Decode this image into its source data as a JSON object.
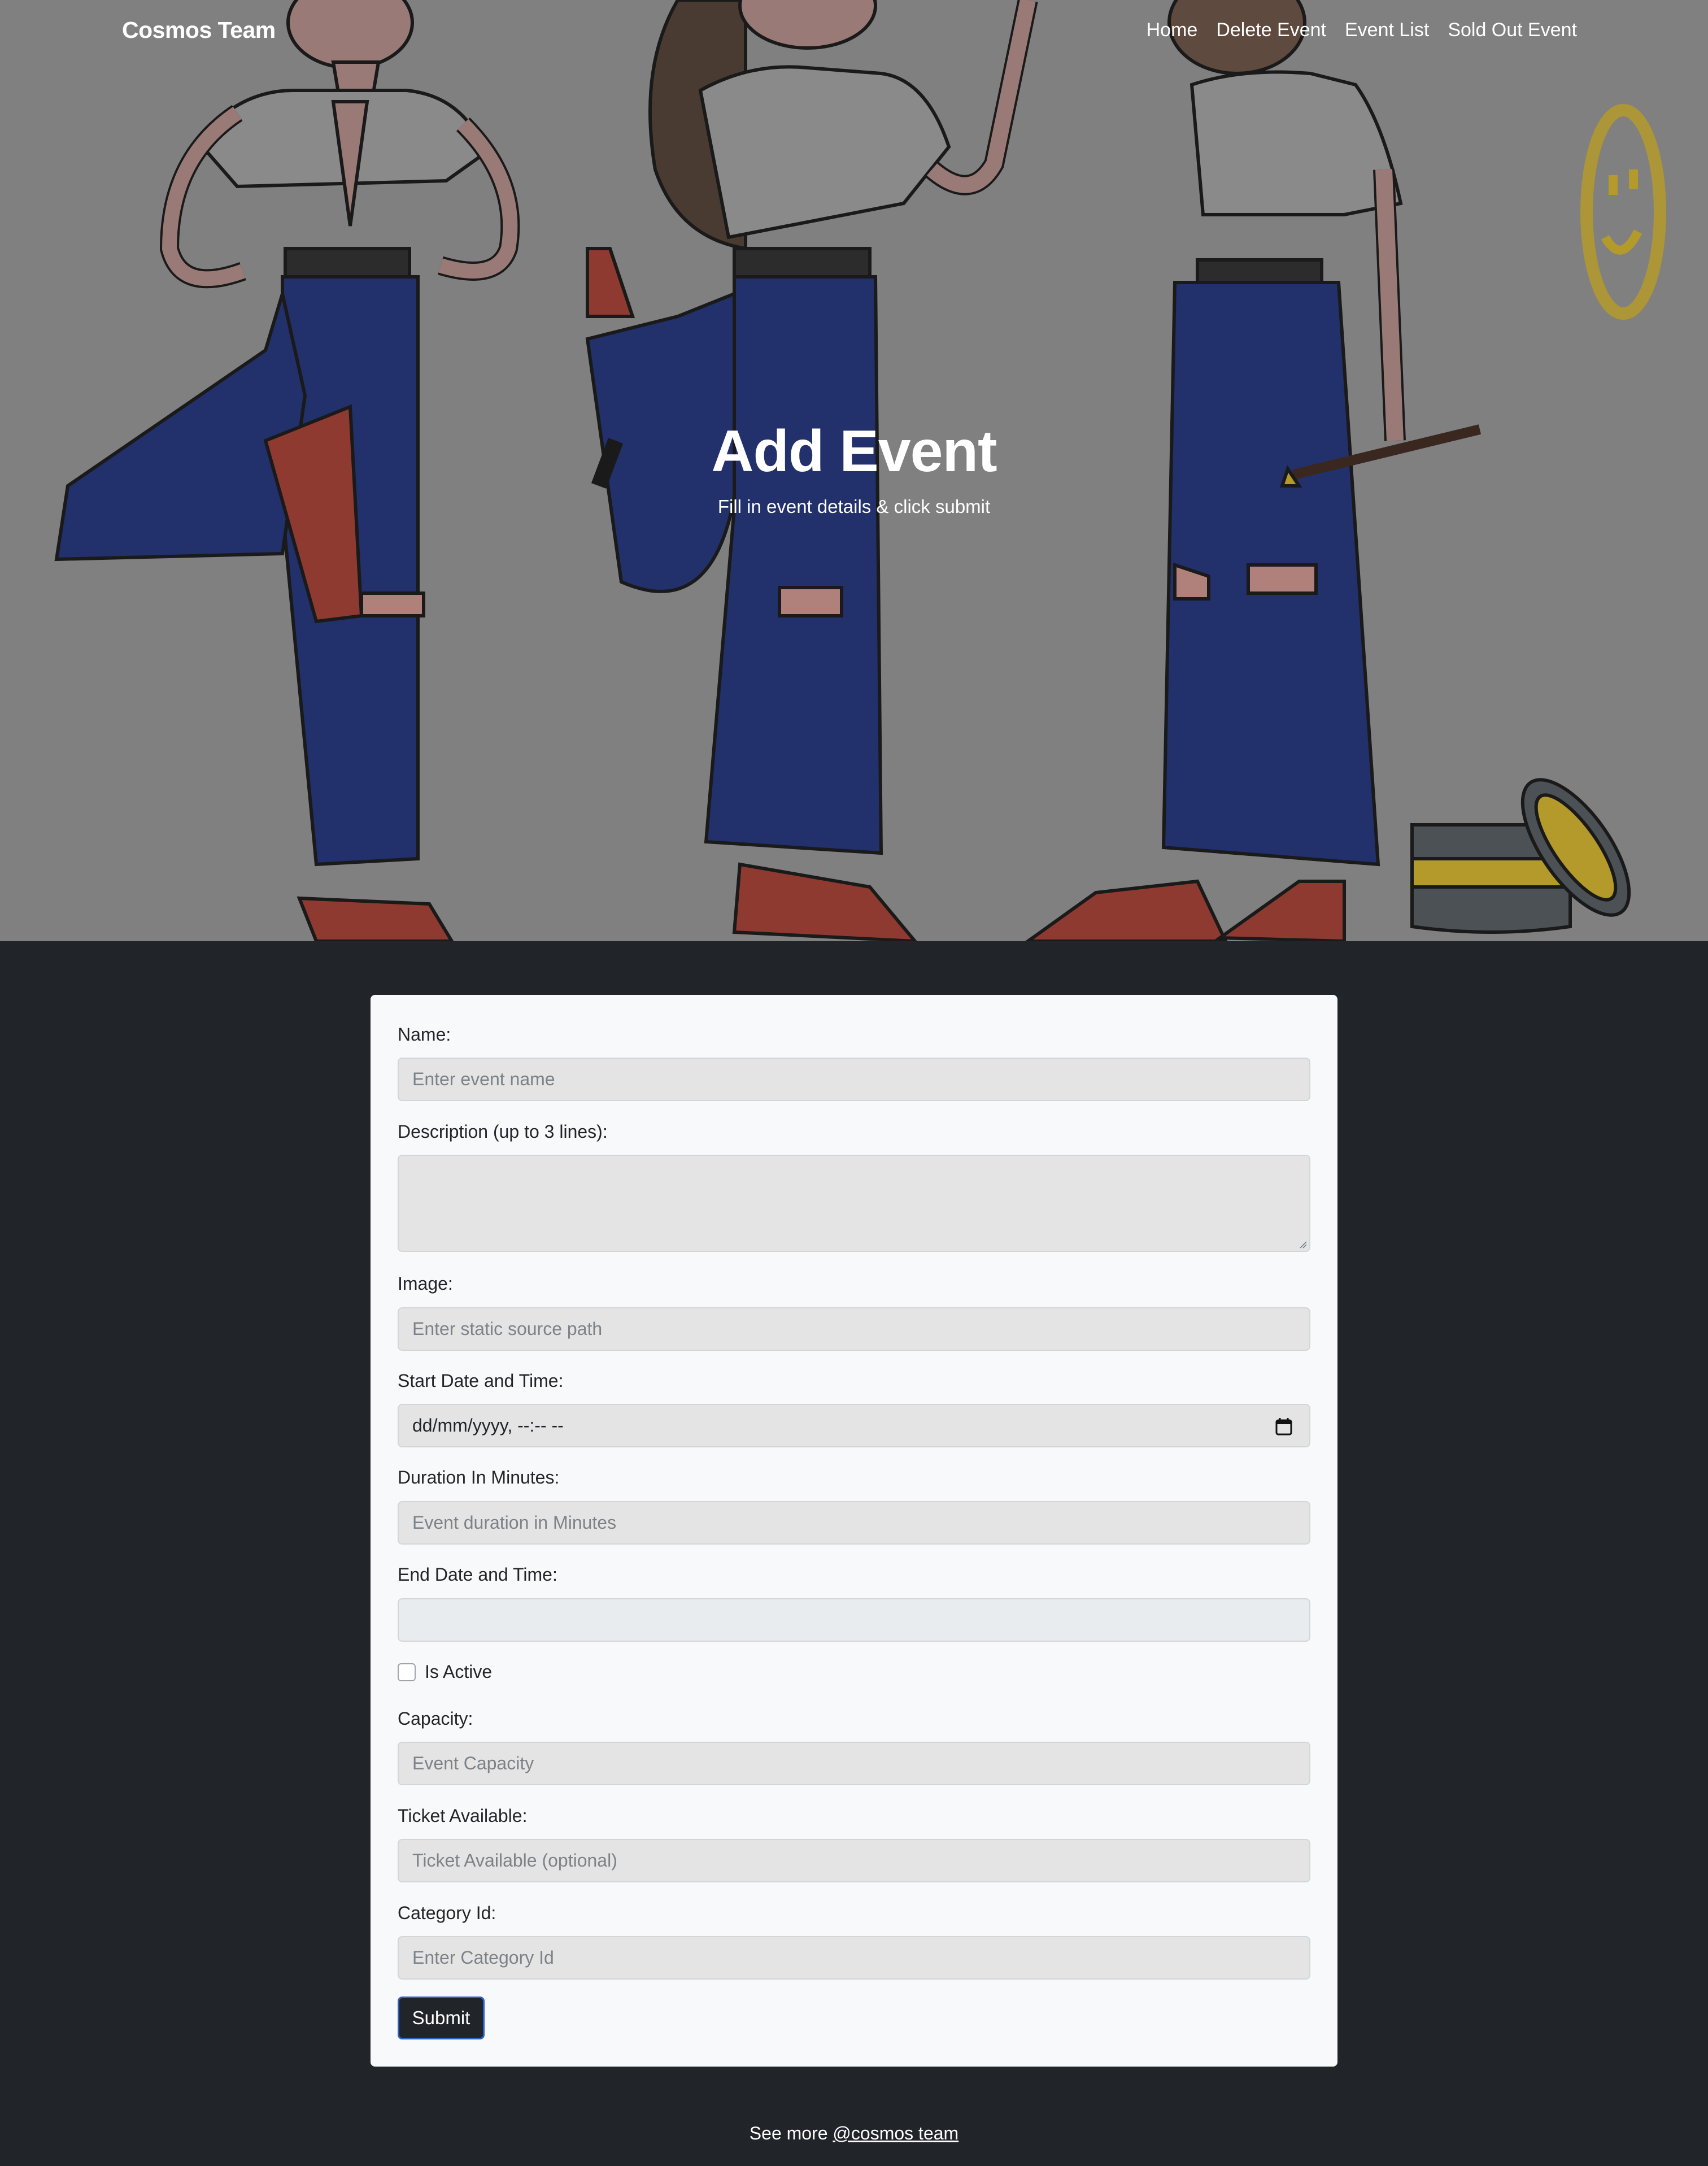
{
  "nav": {
    "brand": "Cosmos Team",
    "links": [
      "Home",
      "Delete Event",
      "Event List",
      "Sold Out Event"
    ]
  },
  "hero": {
    "title": "Add Event",
    "subtitle": "Fill in event details & click submit"
  },
  "form": {
    "name": {
      "label": "Name:",
      "placeholder": "Enter event name"
    },
    "description": {
      "label": "Description (up to 3 lines):",
      "placeholder": ""
    },
    "image": {
      "label": "Image:",
      "placeholder": "Enter static source path"
    },
    "start": {
      "label": "Start Date and Time:",
      "value": "dd/mm/yyyy, --:-- --"
    },
    "duration": {
      "label": "Duration In Minutes:",
      "placeholder": "Event duration in Minutes"
    },
    "end": {
      "label": "End Date and Time:",
      "value": ""
    },
    "is_active": {
      "label": "Is Active",
      "checked": false
    },
    "capacity": {
      "label": "Capacity:",
      "placeholder": "Event Capacity"
    },
    "ticket": {
      "label": "Ticket Available:",
      "placeholder": "Ticket Available (optional)"
    },
    "category": {
      "label": "Category Id:",
      "placeholder": "Enter Category Id"
    },
    "submit": "Submit"
  },
  "footer": {
    "text": "See more",
    "link": "@cosmos team"
  },
  "colors": {
    "hero_overlay": "#808080",
    "page_bg": "#212529",
    "card_bg": "#f8f9fa",
    "input_bg": "#e4e4e4",
    "submit_border": "#2b62c4"
  }
}
